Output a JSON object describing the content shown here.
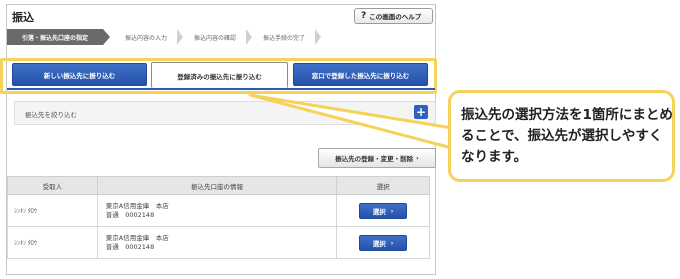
{
  "header": {
    "title": "振込",
    "help_label": "この画面のヘルプ",
    "help_symbol": "?"
  },
  "steps": [
    {
      "label": "引落・振込先口座の指定",
      "active": true
    },
    {
      "label": "振込内容の入力",
      "active": false
    },
    {
      "label": "振込内容の確認",
      "active": false
    },
    {
      "label": "振込手続の完了",
      "active": false
    }
  ],
  "tabs": [
    {
      "label": "新しい振込先に振り込む",
      "selected": false
    },
    {
      "label": "登録済みの振込先に振り込む",
      "selected": true
    },
    {
      "label": "窓口で登録した振込先に振り込む",
      "selected": false
    }
  ],
  "filter": {
    "label": "振込先を絞り込む",
    "expand_symbol": "+"
  },
  "register_button": {
    "label": "振込先の登録・変更・削除",
    "arrow": "›"
  },
  "table": {
    "columns": [
      "受取人",
      "振込先口座の情報",
      "選択"
    ],
    "rows": [
      {
        "name": "ｼﾝｷﾝ ﾀﾛｳ",
        "bank": "東京A信用金庫　本店",
        "account": "普通　0002148",
        "select_label": "選択"
      },
      {
        "name": "ｼﾝｷﾝ ﾀﾛｳ",
        "bank": "東京A信用金庫　本店",
        "account": "普通　0002148",
        "select_label": "選択"
      }
    ]
  },
  "callout": {
    "text": "振込先の選択方法を1箇所にまとめることで、振込先が選択しやすくなります。"
  },
  "colors": {
    "accent_blue": "#2d5bb0",
    "highlight_yellow": "#f5d25a",
    "active_step": "#6a6a6a"
  }
}
